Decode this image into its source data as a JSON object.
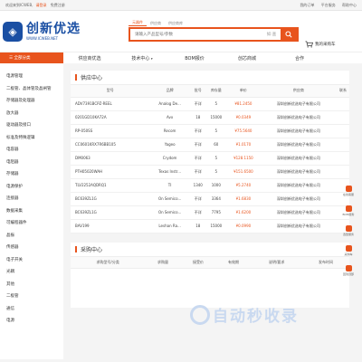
{
  "topbar": {
    "welcome": "欢迎来到ICWEB,",
    "login": "请登录",
    "register": "免费注册",
    "links": [
      "我的订单",
      "平台服务",
      "帮助中心"
    ]
  },
  "logo": {
    "cn": "创新优选",
    "en": "WWW.ICWEB.NET",
    "mark": "◈"
  },
  "search": {
    "tabs": [
      "元器件",
      "供应商",
      "供应商库"
    ],
    "placeholder": "请输入产品型号/参数",
    "match_label": "如:查",
    "button_icon": "search-icon"
  },
  "cart": {
    "label": "我的采购车"
  },
  "nav": {
    "all_label": "全部分类",
    "items": [
      {
        "label": "供应商优选",
        "arrow": ""
      },
      {
        "label": "技术中心",
        "arrow": "▾"
      },
      {
        "label": "BOM报价",
        "arrow": ""
      },
      {
        "label": "创芯商城",
        "arrow": ""
      },
      {
        "label": "合作",
        "arrow": ""
      }
    ]
  },
  "sidebar": [
    "电源管理",
    "二极管、晶体管及晶闸管",
    "存储器及处理器",
    "放大器",
    "驱动器及接口",
    "标准及特殊逻辑",
    "电容器",
    "电阻器",
    "存储器",
    "电源保护",
    "连接器",
    "数据采集",
    "可编程器件",
    "晶振",
    "传感器",
    "电子开关",
    "光耦",
    "其他",
    "二极管",
    "通信",
    "电源"
  ],
  "supply": {
    "title": "供应中心",
    "headers": [
      "型号",
      "品牌",
      "批号",
      "库存量",
      "单价",
      "供应商",
      "联系"
    ],
    "rows": [
      [
        "ADV7391BCPZ-REEL",
        "Analog De...",
        "不详",
        "5",
        "¥81.2450",
        "深圳创新优选电子有限公司",
        ""
      ],
      [
        "0201GD10KA72A",
        "Avx",
        "18",
        "15000",
        "¥0.0349",
        "深圳创新优选电子有限公司",
        ""
      ],
      [
        "RP-050SS",
        "Recom",
        "不详",
        "5",
        "¥75.5640",
        "深圳创新优选电子有限公司",
        ""
      ],
      [
        "CC0601KRX7R6BB105",
        "Yageo",
        "不详",
        "60",
        "¥1.0170",
        "深圳创新优选电子有限公司",
        ""
      ],
      [
        "DM0063",
        "Crydom",
        "不详",
        "5",
        "¥128.1150",
        "深圳创新优选电子有限公司",
        ""
      ],
      [
        "PTH05020WAH",
        "Texas Instr...",
        "不详",
        "5",
        "¥151.6500",
        "深圳创新优选电子有限公司",
        ""
      ],
      [
        "TLV2252AQDRQ1",
        "TI",
        "1340",
        "1000",
        "¥5.2740",
        "深圳创新优选电子有限公司",
        ""
      ],
      [
        "BC639ZL1G",
        "On Semico...",
        "不详",
        "3364",
        "¥1.6830",
        "深圳创新优选电子有限公司",
        ""
      ],
      [
        "BC639ZL1G",
        "On Semico...",
        "不详",
        "7795",
        "¥1.6200",
        "深圳创新优选电子有限公司",
        ""
      ],
      [
        "BAV199",
        "Leshan Ra...",
        "18",
        "15000",
        "¥0.0990",
        "深圳创新优选电子有限公司",
        ""
      ]
    ]
  },
  "purchase": {
    "title": "采购中心",
    "headers": [
      "求购型号/分类",
      "求购量",
      "接受价",
      "有效期",
      "说明/要求",
      "发布时间"
    ]
  },
  "side_tools": [
    "在线客服",
    "BOM服务",
    "选型服务",
    "采购车",
    "回到顶部"
  ],
  "watermark": {
    "text": "自动秒收录",
    "sub": ""
  }
}
